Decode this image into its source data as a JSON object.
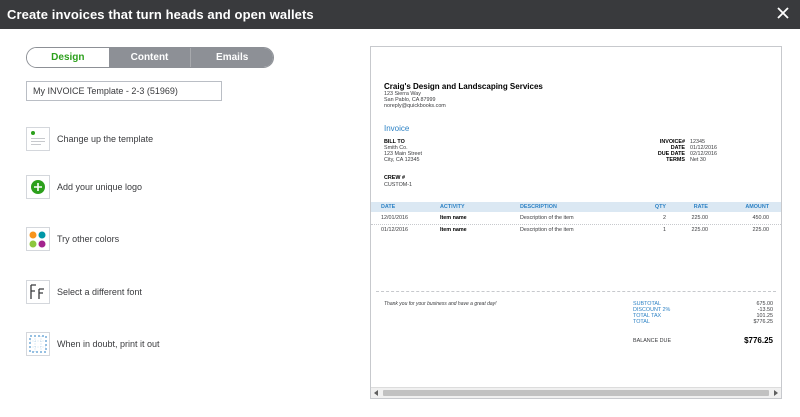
{
  "window": {
    "title": "Create invoices that turn heads and open wallets"
  },
  "tabs": [
    {
      "label": "Design",
      "active": true
    },
    {
      "label": "Content",
      "active": false
    },
    {
      "label": "Emails",
      "active": false
    }
  ],
  "template_name": {
    "value": "My INVOICE Template - 2-3 (51969)"
  },
  "options": [
    {
      "label": "Change up the template",
      "icon": "template-icon"
    },
    {
      "label": "Add your unique logo",
      "icon": "add-logo-icon"
    },
    {
      "label": "Try other colors",
      "icon": "color-palette-icon"
    },
    {
      "label": "Select a different font",
      "icon": "font-icon"
    },
    {
      "label": "When in doubt, print it out",
      "icon": "print-icon"
    }
  ],
  "colors": {
    "accent_green": "#2ca01c",
    "header_bar": "#393a3d",
    "invoice_blue": "#2d82c5",
    "palette": [
      "#f7941d",
      "#0097a7",
      "#8dc63f",
      "#a3238e"
    ]
  },
  "invoice": {
    "company": "Craig's Design and Landscaping Services",
    "address": [
      "123 Sierra Way",
      "San Pablo, CA 87999",
      "noreply@quickbooks.com"
    ],
    "heading": "Invoice",
    "bill_to": {
      "label": "BILL TO",
      "lines": [
        "Smith Co.",
        "123 Main Street",
        "City, CA 12345"
      ]
    },
    "crew": {
      "label": "CREW #",
      "value": "CUSTOM-1"
    },
    "meta": [
      {
        "key": "INVOICE#",
        "value": "12345"
      },
      {
        "key": "DATE",
        "value": "01/12/2016"
      },
      {
        "key": "DUE DATE",
        "value": "02/12/2016"
      },
      {
        "key": "TERMS",
        "value": "Net 30"
      }
    ],
    "columns": {
      "date": "DATE",
      "activity": "ACTIVITY",
      "description": "DESCRIPTION",
      "qty": "QTY",
      "rate": "RATE",
      "amount": "AMOUNT"
    },
    "rows": [
      {
        "date": "12/01/2016",
        "activity": "Item name",
        "description": "Description of the item",
        "qty": "2",
        "rate": "225.00",
        "amount": "450.00"
      },
      {
        "date": "01/12/2016",
        "activity": "Item name",
        "description": "Description of the item",
        "qty": "1",
        "rate": "225.00",
        "amount": "225.00"
      }
    ],
    "thanks": "Thank you for your business and have a great day!",
    "totals": [
      {
        "key": "SUBTOTAL",
        "value": "675.00"
      },
      {
        "key": "DISCOUNT 2%",
        "value": "-13.50"
      },
      {
        "key": "TOTAL TAX",
        "value": "101.25"
      },
      {
        "key": "TOTAL",
        "value": "$776.25"
      }
    ],
    "balance": {
      "key": "BALANCE DUE",
      "value": "$776.25"
    }
  }
}
